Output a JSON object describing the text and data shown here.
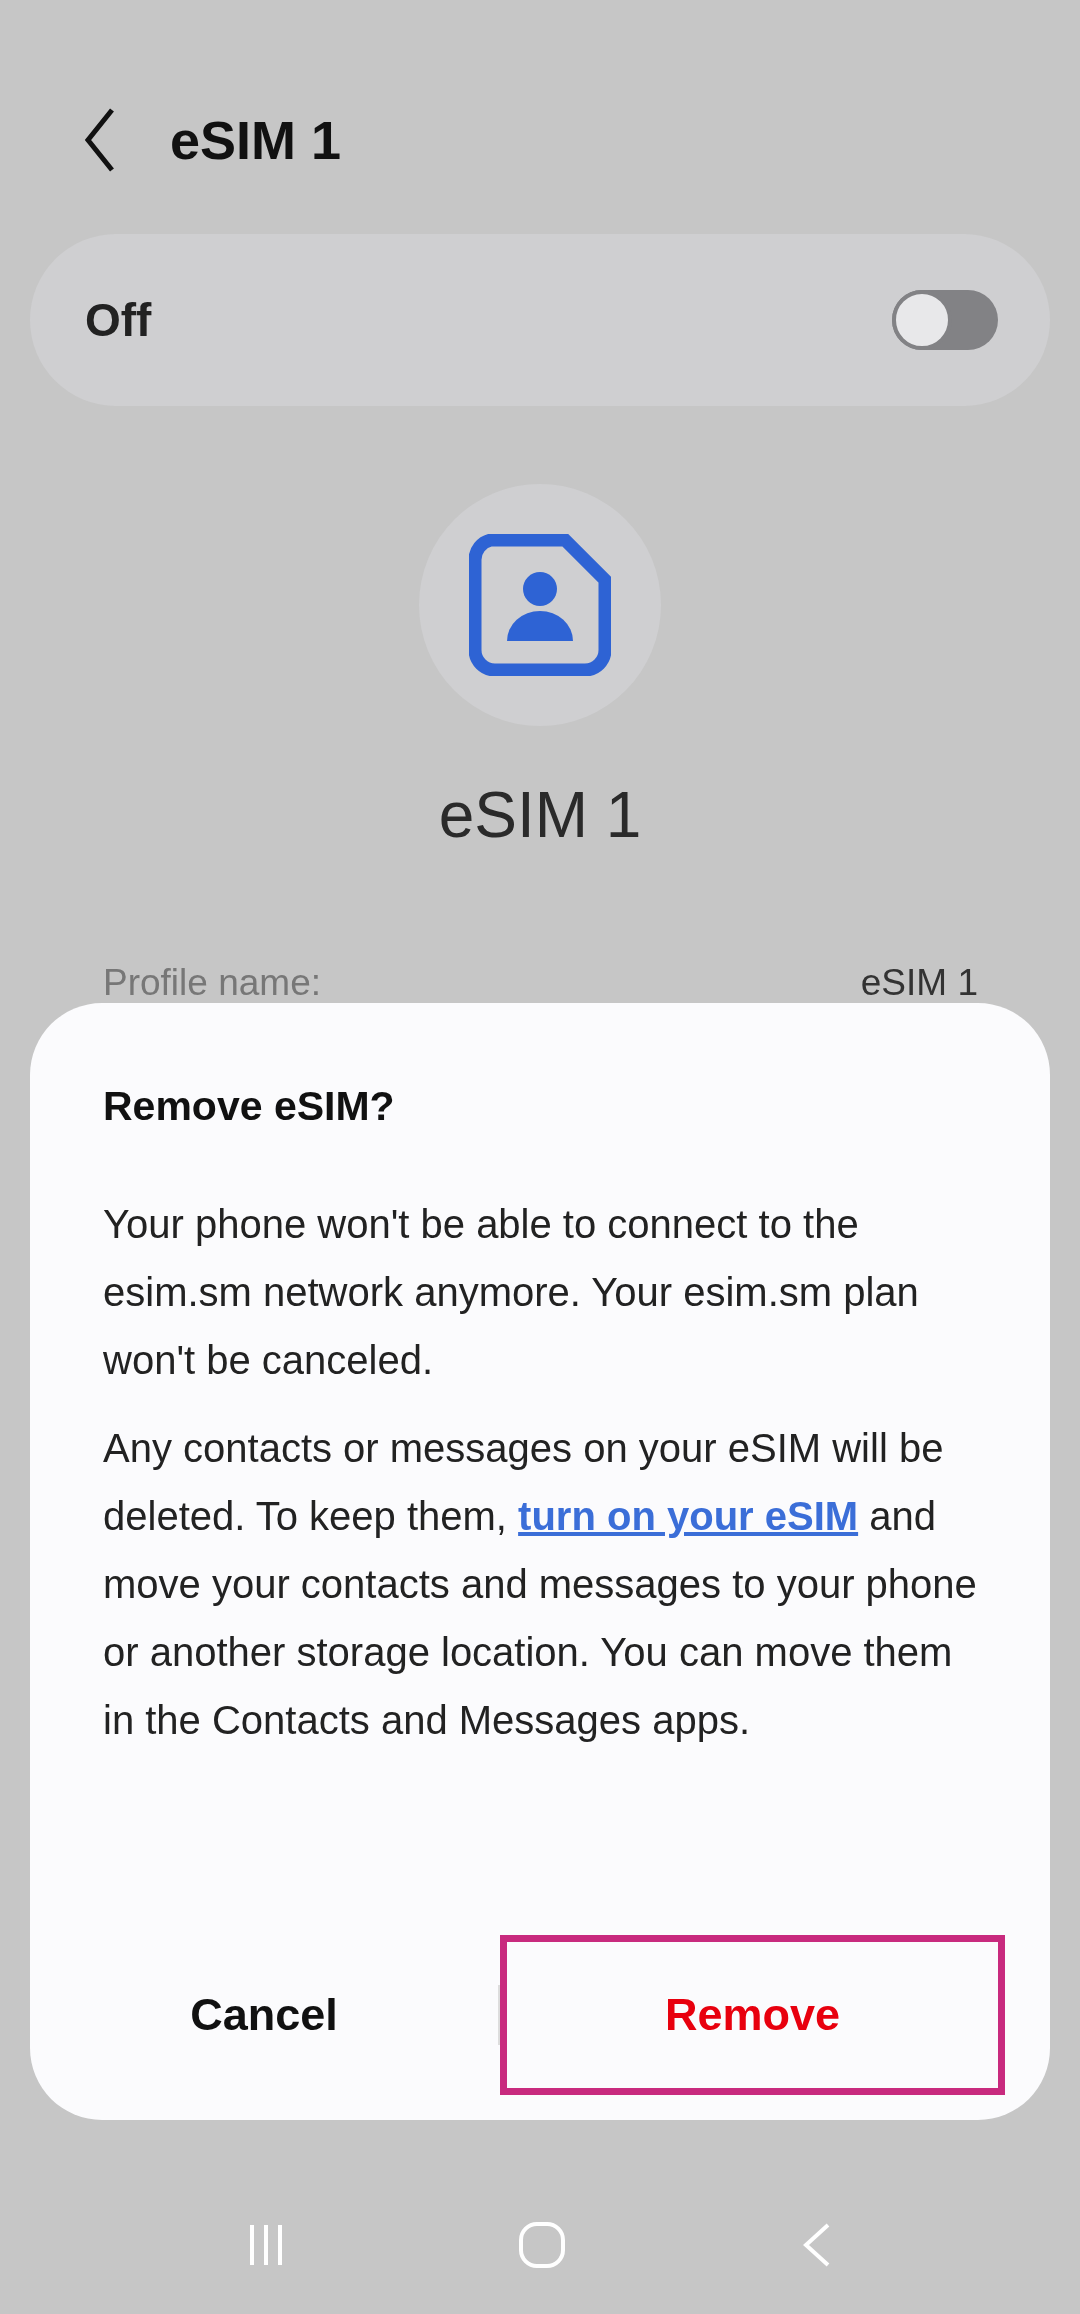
{
  "header": {
    "title": "eSIM 1"
  },
  "switch_card": {
    "label": "Off",
    "on": false
  },
  "profile": {
    "name": "eSIM 1"
  },
  "details": [
    {
      "label": "Profile name:",
      "value": "eSIM 1"
    }
  ],
  "dialog": {
    "title": "Remove eSIM?",
    "paragraphs": [
      {
        "before": "Your phone won't be able to connect to the esim.sm network anymore. Your esim.sm plan won't be canceled."
      },
      {
        "before": "Any contacts or messages on your eSIM will be deleted. To keep them, ",
        "link": "turn on your eSIM",
        "after": " and move your contacts and messages to your phone or another storage location. You can move them in the Contacts and Messages apps."
      }
    ],
    "buttons": [
      {
        "label": "Cancel",
        "kind": "neutral",
        "highlighted": false
      },
      {
        "label": "Remove",
        "kind": "destructive",
        "highlighted": true
      }
    ]
  }
}
